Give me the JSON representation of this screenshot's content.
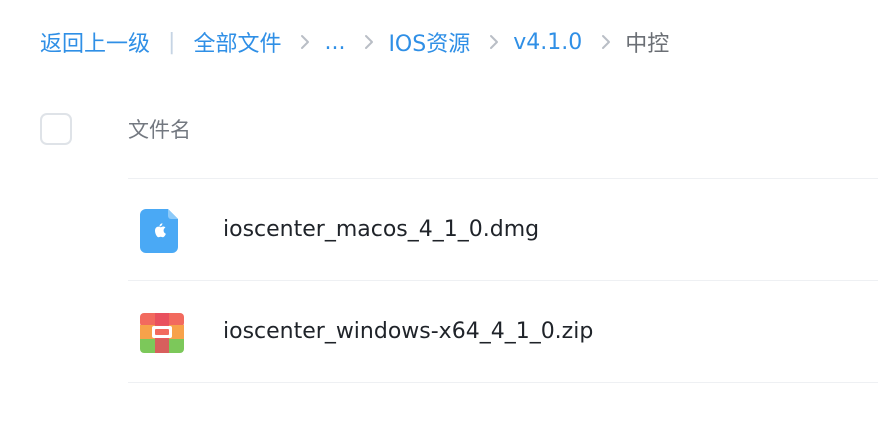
{
  "breadcrumb": {
    "back": "返回上一级",
    "separator": "|",
    "items": [
      {
        "label": "全部文件"
      },
      {
        "label": "..."
      },
      {
        "label": "IOS资源"
      },
      {
        "label": "v4.1.0"
      },
      {
        "label": "中控"
      }
    ]
  },
  "list_header": {
    "name_column": "文件名"
  },
  "files": [
    {
      "name": "ioscenter_macos_4_1_0.dmg",
      "icon": "apple-dmg-icon"
    },
    {
      "name": "ioscenter_windows-x64_4_1_0.zip",
      "icon": "zip-archive-icon"
    }
  ],
  "colors": {
    "link": "#2f8fe6",
    "current": "#6b6f75",
    "text": "#1f2329",
    "divider": "#eef0f3"
  }
}
